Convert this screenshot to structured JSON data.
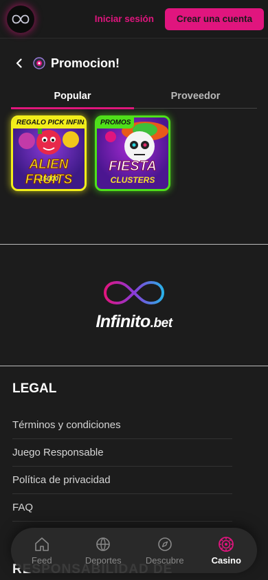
{
  "header": {
    "login_label": "Iniciar sesión",
    "register_label": "Crear una cuenta"
  },
  "page": {
    "title": "Promocion!"
  },
  "tabs": [
    {
      "label": "Popular",
      "active": true
    },
    {
      "label": "Proveedor",
      "active": false
    }
  ],
  "games": [
    {
      "badge": "REGALO PICK INFINITO",
      "name": "ALIEN FRUITS",
      "subtitle": "15000",
      "color": "#f2ee1a"
    },
    {
      "badge": "PROMOS",
      "name": "FIESTA",
      "subtitle": "CLUSTERS",
      "color": "#4fe01a"
    }
  ],
  "footer": {
    "brand": "Infinito",
    "brand_suffix": ".bet",
    "legal_title": "LEGAL",
    "legal_links": [
      "Términos y condiciones",
      "Juego Responsable",
      "Política de privacidad",
      "FAQ"
    ],
    "next_heading_partial": "RESPONSABILIDAD DE"
  },
  "bottom_nav": [
    {
      "label": "Feed",
      "icon": "home-icon",
      "active": false
    },
    {
      "label": "Deportes",
      "icon": "sports-ball-icon",
      "active": false
    },
    {
      "label": "Descubre",
      "icon": "compass-icon",
      "active": false
    },
    {
      "label": "Casino",
      "icon": "casino-chip-icon",
      "active": true
    }
  ],
  "colors": {
    "accent": "#e0157e",
    "background": "#1c1c1c"
  }
}
